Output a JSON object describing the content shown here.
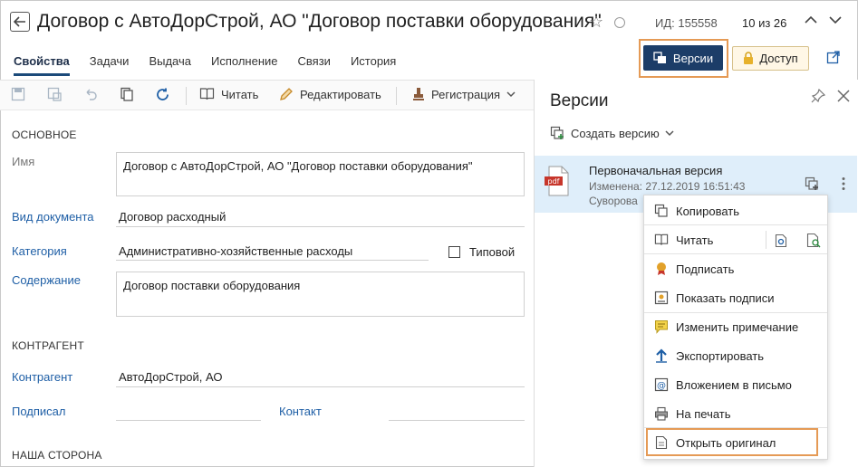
{
  "header": {
    "title": "Договор с АвтоДорСтрой, АО \"Договор поставки оборудования\"",
    "id_text": "ИД: 155558",
    "counter": "10 из 26"
  },
  "tabs": [
    "Свойства",
    "Задачи",
    "Выдача",
    "Исполнение",
    "Связи",
    "История"
  ],
  "actions": {
    "versions_label": "Версии",
    "access_label": "Доступ"
  },
  "toolbar": {
    "read_label": "Читать",
    "edit_label": "Редактировать",
    "registration_label": "Регистрация"
  },
  "form": {
    "main_section": "ОСНОВНОЕ",
    "name_label": "Имя",
    "name_value": "Договор с АвтоДорСтрой, АО \"Договор поставки оборудования\"",
    "doctype_label": "Вид документа",
    "doctype_value": "Договор расходный",
    "category_label": "Категория",
    "category_value": "Административно-хозяйственные расходы",
    "typical_label": "Типовой",
    "content_label": "Содержание",
    "content_value": "Договор поставки оборудования",
    "counterparty_section": "КОНТРАГЕНТ",
    "counterparty_label": "Контрагент",
    "counterparty_value": "АвтоДорСтрой, АО",
    "signed_label": "Подписал",
    "contact_label": "Контакт",
    "our_side_section": "НАША СТОРОНА"
  },
  "panel": {
    "title": "Версии",
    "create_version": "Создать версию",
    "version": {
      "file_type": "pdf",
      "name": "Первоначальная версия",
      "modified": "Изменена: 27.12.2019 16:51:43",
      "author": "Суворова"
    }
  },
  "context_menu": {
    "copy": "Копировать",
    "read": "Читать",
    "sign": "Подписать",
    "show_signatures": "Показать подписи",
    "edit_note": "Изменить примечание",
    "export": "Экспортировать",
    "attach_to_email": "Вложением в письмо",
    "print": "На печать",
    "open_original": "Открыть оригинал"
  },
  "colors": {
    "accent": "#1c3d68",
    "link": "#1f5fa6",
    "highlight": "#e59a55",
    "selected_row": "#dfeefa"
  }
}
